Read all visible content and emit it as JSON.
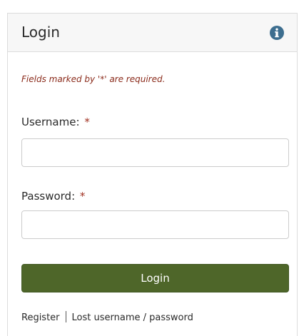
{
  "panel": {
    "title": "Login"
  },
  "form": {
    "required_note": "Fields marked by '*' are required.",
    "username": {
      "label": "Username:",
      "required_marker": "*",
      "value": "",
      "placeholder": ""
    },
    "password": {
      "label": "Password:",
      "required_marker": "*",
      "value": "",
      "placeholder": ""
    },
    "submit_label": "Login"
  },
  "links": {
    "register": "Register",
    "lost_credentials": "Lost username / password"
  },
  "icons": {
    "info": "info-icon"
  },
  "colors": {
    "accent": "#4e6629",
    "info_icon": "#3d6e8f",
    "required": "#a03020"
  }
}
